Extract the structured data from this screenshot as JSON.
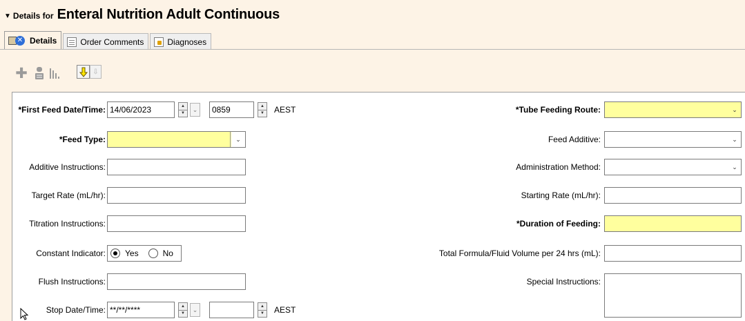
{
  "header": {
    "toggle": "▼",
    "prefix": "Details for",
    "title": "Enteral Nutrition Adult Continuous"
  },
  "tabs": [
    {
      "label": "Details",
      "icon": "details-icon",
      "active": true
    },
    {
      "label": "Order Comments",
      "icon": "order-comments-icon",
      "active": false
    },
    {
      "label": "Diagnoses",
      "icon": "diagnoses-icon",
      "active": false
    }
  ],
  "toolbar": {
    "add": "add-icon",
    "pill": "medication-icon",
    "bars": "chart-bars-icon",
    "arrow": "⇩",
    "arrow2": "⇩"
  },
  "form": {
    "first_feed": {
      "label": "*First Feed Date/Time:",
      "date": "14/06/2023",
      "time": "0859",
      "tz": "AEST"
    },
    "tube_route": {
      "label": "*Tube Feeding Route:",
      "value": ""
    },
    "feed_type": {
      "label": "*Feed Type:",
      "value": ""
    },
    "feed_additive": {
      "label": "Feed Additive:",
      "value": ""
    },
    "additive_instructions": {
      "label": "Additive Instructions:",
      "value": ""
    },
    "administration_method": {
      "label": "Administration Method:",
      "value": ""
    },
    "target_rate": {
      "label": "Target Rate (mL/hr):",
      "value": ""
    },
    "starting_rate": {
      "label": "Starting Rate (mL/hr):",
      "value": ""
    },
    "titration_instructions": {
      "label": "Titration Instructions:",
      "value": ""
    },
    "duration_feeding": {
      "label": "*Duration of Feeding:",
      "value": ""
    },
    "constant_indicator": {
      "label": "Constant Indicator:",
      "yes": "Yes",
      "no": "No",
      "selected": "Yes"
    },
    "total_volume": {
      "label": "Total Formula/Fluid Volume per 24 hrs (mL):",
      "value": ""
    },
    "flush_instructions": {
      "label": "Flush Instructions:",
      "value": ""
    },
    "special_instructions": {
      "label": "Special Instructions:",
      "value": ""
    },
    "stop_date": {
      "label": "Stop Date/Time:",
      "date": "**/**/****",
      "time": "",
      "tz": "AEST"
    }
  },
  "colors": {
    "background": "#fdf3e6",
    "required_field": "#ffff9e",
    "panel": "#ffffff"
  }
}
